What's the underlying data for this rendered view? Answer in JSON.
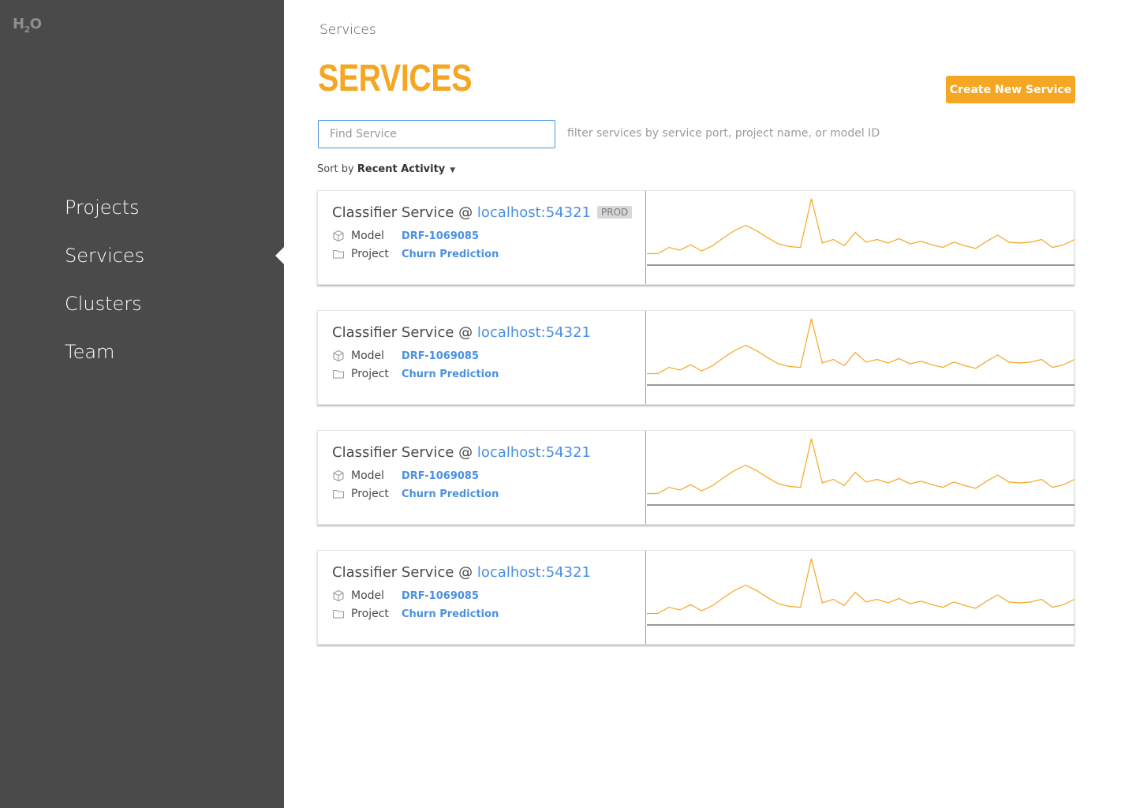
{
  "logo": {
    "main": "H",
    "sub": "2",
    "end": "O"
  },
  "sidebar": {
    "items": [
      {
        "label": "Projects"
      },
      {
        "label": "Services"
      },
      {
        "label": "Clusters"
      },
      {
        "label": "Team"
      }
    ],
    "active": "Services"
  },
  "breadcrumb": "Services",
  "page_title": "SERVICES",
  "create_button": "Create New Service",
  "search": {
    "placeholder": "Find Service",
    "value": "",
    "hint": "filter services by service port, project name, or model ID"
  },
  "sort": {
    "prefix": "Sort by",
    "value": "Recent Activity"
  },
  "colors": {
    "accent": "#f5a623",
    "link": "#4a90e2",
    "sidebar_bg": "#4a4a4a"
  },
  "services": [
    {
      "name": "Classifier Service @",
      "host": "localhost:54321",
      "badge": "PROD",
      "model_label": "Model",
      "model_id": "DRF-1069085",
      "project_label": "Project",
      "project_name": "Churn Prediction"
    },
    {
      "name": "Classifier Service @",
      "host": "localhost:54321",
      "badge": "",
      "model_label": "Model",
      "model_id": "DRF-1069085",
      "project_label": "Project",
      "project_name": "Churn Prediction"
    },
    {
      "name": "Classifier Service @",
      "host": "localhost:54321",
      "badge": "",
      "model_label": "Model",
      "model_id": "DRF-1069085",
      "project_label": "Project",
      "project_name": "Churn Prediction"
    },
    {
      "name": "Classifier Service @",
      "host": "localhost:54321",
      "badge": "",
      "model_label": "Model",
      "model_id": "DRF-1069085",
      "project_label": "Project",
      "project_name": "Churn Prediction"
    }
  ],
  "chart_data": {
    "type": "line",
    "series": [
      {
        "values": [
          4,
          4,
          11,
          8,
          14,
          7,
          13,
          22,
          30,
          36,
          30,
          22,
          15,
          12,
          11,
          66,
          16,
          20,
          13,
          28,
          17,
          20,
          16,
          21,
          15,
          18,
          14,
          11,
          17,
          13,
          10,
          18,
          25,
          17,
          16,
          17,
          20,
          11,
          14,
          20
        ]
      }
    ],
    "ylim": [
      0,
      80
    ],
    "color": "#f5a623"
  }
}
